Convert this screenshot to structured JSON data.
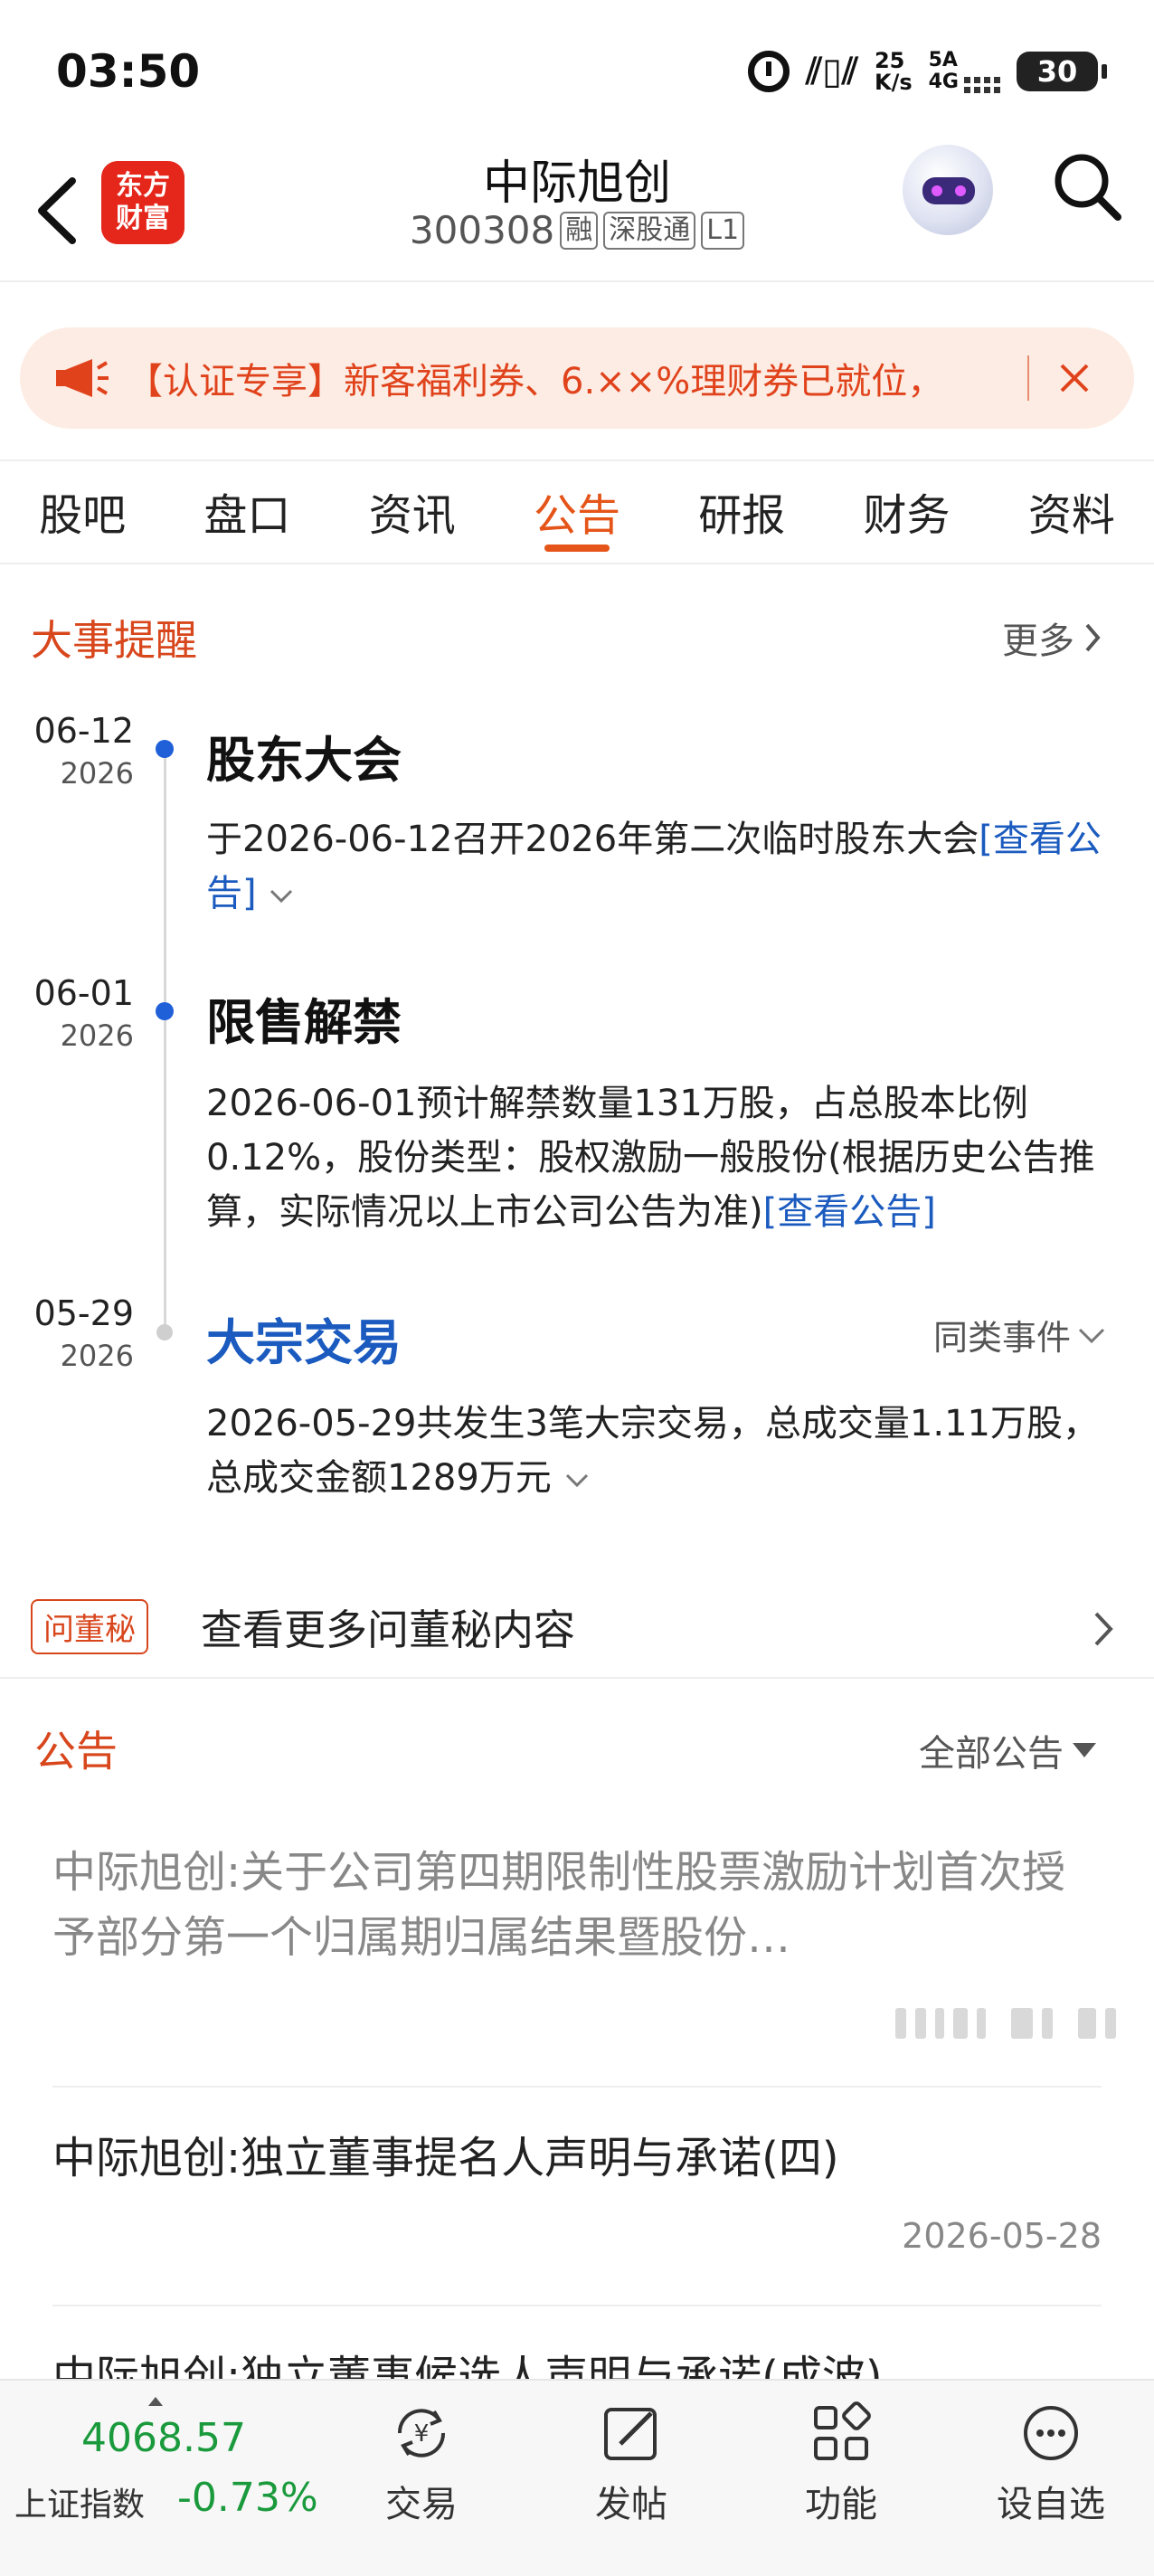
{
  "status_bar": {
    "time": "03:50",
    "network_speed_value": "25",
    "network_speed_unit": "K/s",
    "network_top": "5A",
    "network_bottom": "4G",
    "battery": "30"
  },
  "header": {
    "logo_line1": "东方",
    "logo_line2": "财富",
    "stock_name": "中际旭创",
    "stock_code": "300308",
    "tags": [
      "融",
      "深股通",
      "L1"
    ]
  },
  "banner": {
    "text": "【认证专享】新客福利券、6.××%理财券已就位，"
  },
  "tabs": [
    "股吧",
    "盘口",
    "资讯",
    "公告",
    "研报",
    "财务",
    "资料"
  ],
  "active_tab_index": 3,
  "events_section": {
    "title": "大事提醒",
    "more": "更多",
    "events": [
      {
        "date": "06-12",
        "year": "2026",
        "title": "股东大会",
        "body": "于2026-06-12召开2026年第二次临时股东大会",
        "link": "[查看公告]"
      },
      {
        "date": "06-01",
        "year": "2026",
        "title": "限售解禁",
        "body": "2026-06-01预计解禁数量131万股，占总股本比例0.12%，股份类型：股权激励一般股份(根据历史公告推算，实际情况以上市公司公告为准)",
        "link": "[查看公告]"
      },
      {
        "date": "05-29",
        "year": "2026",
        "title": "大宗交易",
        "same_event": "同类事件",
        "body": "2026-05-29共发生3笔大宗交易，总成交量1.11万股，总成交金额1289万元"
      }
    ]
  },
  "ask_secretary": {
    "tag": "问董秘",
    "text": "查看更多问董秘内容"
  },
  "announcements_section": {
    "title": "公告",
    "filter": "全部公告",
    "items": [
      {
        "title": "中际旭创:关于公司第四期限制性股票激励计划首次授予部分第一个归属期归属结果暨股份…"
      },
      {
        "title": "中际旭创:独立董事提名人声明与承诺(四)",
        "date": "2026-05-28"
      },
      {
        "title": "中际旭创:独立董事候选人声明与承诺(成波)"
      }
    ]
  },
  "bottom_bar": {
    "index_value": "4068.57",
    "index_name": "上证指数",
    "index_change": "-0.73%",
    "colors": {
      "index_down": "#1a9a3c",
      "accent": "#e55419"
    },
    "nav": [
      {
        "label": "交易",
        "icon": "yen-exchange-icon"
      },
      {
        "label": "发帖",
        "icon": "edit-post-icon"
      },
      {
        "label": "功能",
        "icon": "grid-apps-icon"
      },
      {
        "label": "设自选",
        "icon": "more-dots-icon"
      }
    ]
  }
}
